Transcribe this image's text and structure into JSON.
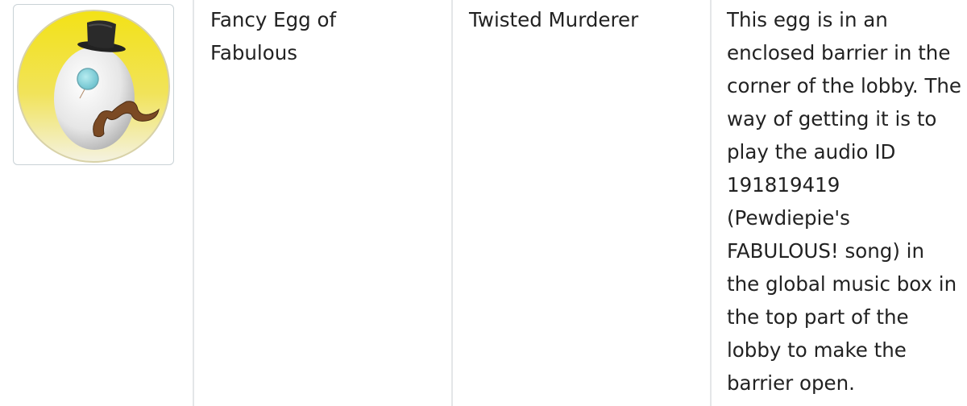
{
  "row": {
    "image": {
      "alt": "Fancy Egg of Fabulous",
      "icon": "egg-with-top-hat-monocle-mustache",
      "colors": {
        "background_top": "#f2e21a",
        "background_bottom": "#f5f3df",
        "egg": "#eeeeee",
        "hat": "#1e1e1e",
        "monocle": "#8fd6df",
        "mustache": "#7a4a26",
        "frame_border": "#c9d2d6"
      }
    },
    "name": "Fancy Egg of\nFabulous",
    "location": "Twisted Murderer",
    "description": "This egg is in an enclosed barrier in the corner of the lobby. The way of getting it is to play the audio ID 191819419 (Pewdiepie's FABULOUS! song) in the global music box in the top part of the lobby to make the barrier open."
  },
  "colors": {
    "divider": "#e4e6e8",
    "text": "#222222"
  }
}
